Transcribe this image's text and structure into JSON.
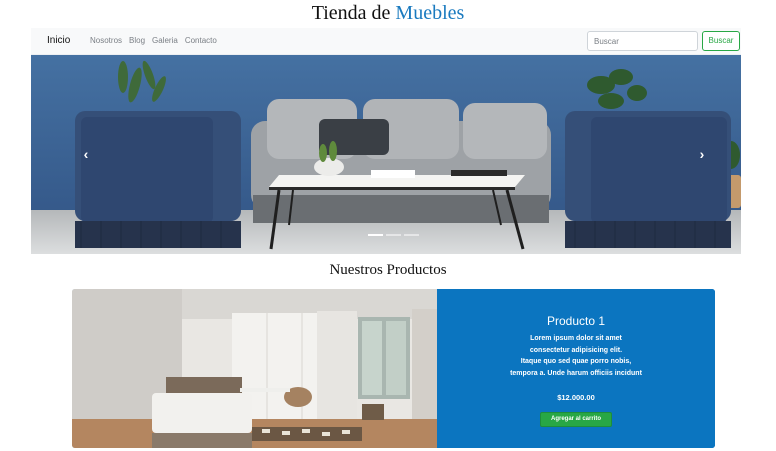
{
  "site": {
    "title_part1": "Tienda de",
    "title_part2": "Muebles",
    "accent_color": "#1a7abf"
  },
  "navbar": {
    "brand": "Inicio",
    "links": [
      "Nosotros",
      "Blog",
      "Galeria",
      "Contacto"
    ],
    "search": {
      "placeholder": "Buscar",
      "button_label": "Buscar"
    },
    "button_color": "#28a745"
  },
  "carousel": {
    "prev_icon": "chevron-left-icon",
    "next_icon": "chevron-right-icon",
    "prev_glyph": "‹",
    "next_glyph": "›",
    "active_slide": 1,
    "slide_count": 3
  },
  "products_section": {
    "title": "Nuestros Productos"
  },
  "product": {
    "title": "Producto 1",
    "description_lines": [
      "Lorem ipsum dolor sit amet",
      "consectetur adipisicing elit.",
      "Itaque quo sed quae porro nobis,",
      "tempora a. Unde harum officiis incidunt"
    ],
    "price": "$12.000.00",
    "button_label": "Agregar al carrito",
    "panel_color": "#0b75c0"
  }
}
